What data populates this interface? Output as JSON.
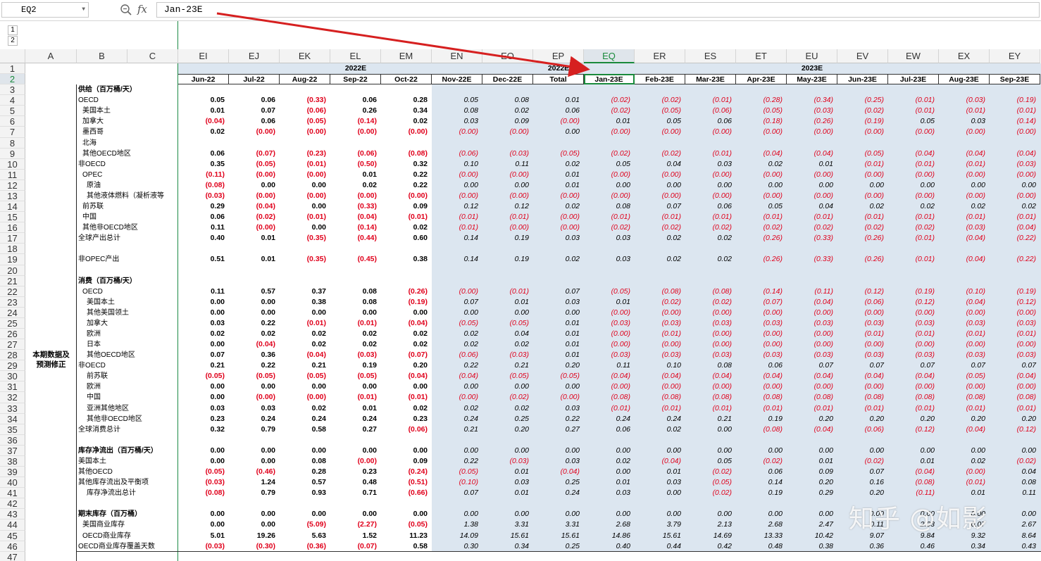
{
  "formula_bar": {
    "name_box": "EQ2",
    "formula": "Jan-23E",
    "fx_label": "fx",
    "zoom_icon": "magnifier-icon"
  },
  "outline_levels": [
    "1",
    "2"
  ],
  "columns": [
    "A",
    "B",
    "C",
    "EI",
    "EJ",
    "EK",
    "EL",
    "EM",
    "EN",
    "EO",
    "EP",
    "EQ",
    "ER",
    "ES",
    "ET",
    "EU",
    "EV",
    "EW",
    "EX",
    "EY"
  ],
  "selected_column": "EQ",
  "selected_row": 2,
  "row1": {
    "year_2022E": "2022E",
    "year_2022E_total": "2022E",
    "year_2023E": "2023E"
  },
  "row2": [
    "Jun-22",
    "Jul-22",
    "Aug-22",
    "Sep-22",
    "Oct-22",
    "Nov-22E",
    "Dec-22E",
    "Total",
    "Jan-23E",
    "Feb-23E",
    "Mar-23E",
    "Apr-23E",
    "May-23E",
    "Jun-23E",
    "Jul-23E",
    "Aug-23E",
    "Sep-23E"
  ],
  "merged_label": "本期数据及\n预测修正",
  "rows": [
    {
      "r": 3,
      "label": "供给（百万桶/天）",
      "indent": 0,
      "bold": true,
      "v": null
    },
    {
      "r": 4,
      "label": "OECD",
      "indent": 0,
      "v": [
        "0.05",
        "0.06",
        "(0.33)",
        "0.06",
        "0.28",
        "0.05",
        "0.08",
        "0.01",
        "(0.02)",
        "(0.02)",
        "(0.01)",
        "(0.28)",
        "(0.34)",
        "(0.25)",
        "(0.01)",
        "(0.03)",
        "(0.19)"
      ]
    },
    {
      "r": 5,
      "label": "美国本土",
      "indent": 2,
      "v": [
        "0.01",
        "0.07",
        "(0.06)",
        "0.26",
        "0.34",
        "0.08",
        "0.02",
        "0.06",
        "(0.02)",
        "(0.05)",
        "(0.06)",
        "(0.05)",
        "(0.03)",
        "(0.02)",
        "(0.01)",
        "(0.01)",
        "(0.01)"
      ]
    },
    {
      "r": 6,
      "label": "加拿大",
      "indent": 2,
      "v": [
        "(0.04)",
        "0.06",
        "(0.05)",
        "(0.14)",
        "0.02",
        "0.03",
        "0.09",
        "(0.00)",
        "0.01",
        "0.05",
        "0.06",
        "(0.18)",
        "(0.26)",
        "(0.19)",
        "0.05",
        "0.03",
        "(0.14)"
      ]
    },
    {
      "r": 7,
      "label": "墨西哥",
      "indent": 2,
      "v": [
        "0.02",
        "(0.00)",
        "(0.00)",
        "(0.00)",
        "(0.00)",
        "(0.00)",
        "(0.00)",
        "0.00",
        "(0.00)",
        "(0.00)",
        "(0.00)",
        "(0.00)",
        "(0.00)",
        "(0.00)",
        "(0.00)",
        "(0.00)",
        "(0.00)"
      ]
    },
    {
      "r": 8,
      "label": "北海",
      "indent": 2,
      "v": null
    },
    {
      "r": 9,
      "label": "其他OECD地区",
      "indent": 2,
      "v": [
        "0.06",
        "(0.07)",
        "(0.23)",
        "(0.06)",
        "(0.08)",
        "(0.06)",
        "(0.03)",
        "(0.05)",
        "(0.02)",
        "(0.02)",
        "(0.01)",
        "(0.04)",
        "(0.04)",
        "(0.05)",
        "(0.04)",
        "(0.04)",
        "(0.04)"
      ]
    },
    {
      "r": 10,
      "label": "非OECD",
      "indent": 0,
      "v": [
        "0.35",
        "(0.05)",
        "(0.01)",
        "(0.50)",
        "0.32",
        "0.10",
        "0.11",
        "0.02",
        "0.05",
        "0.04",
        "0.03",
        "0.02",
        "0.01",
        "(0.01)",
        "(0.01)",
        "(0.01)",
        "(0.03)"
      ]
    },
    {
      "r": 11,
      "label": "OPEC",
      "indent": 2,
      "v": [
        "(0.11)",
        "(0.00)",
        "(0.00)",
        "0.01",
        "0.22",
        "(0.00)",
        "(0.00)",
        "0.01",
        "(0.00)",
        "(0.00)",
        "(0.00)",
        "(0.00)",
        "(0.00)",
        "(0.00)",
        "(0.00)",
        "(0.00)",
        "(0.00)"
      ]
    },
    {
      "r": 12,
      "label": "原油",
      "indent": 4,
      "v": [
        "(0.08)",
        "0.00",
        "0.00",
        "0.02",
        "0.22",
        "0.00",
        "0.00",
        "0.01",
        "0.00",
        "0.00",
        "0.00",
        "0.00",
        "0.00",
        "0.00",
        "0.00",
        "0.00",
        "0.00"
      ]
    },
    {
      "r": 13,
      "label": "其他液体燃料（凝析液等",
      "indent": 4,
      "v": [
        "(0.03)",
        "(0.00)",
        "(0.00)",
        "(0.00)",
        "(0.00)",
        "(0.00)",
        "(0.00)",
        "(0.00)",
        "(0.00)",
        "(0.00)",
        "(0.00)",
        "(0.00)",
        "(0.00)",
        "(0.00)",
        "(0.00)",
        "(0.00)",
        "(0.00)"
      ]
    },
    {
      "r": 14,
      "label": "前苏联",
      "indent": 2,
      "v": [
        "0.29",
        "(0.04)",
        "0.00",
        "(0.33)",
        "0.09",
        "0.12",
        "0.12",
        "0.02",
        "0.08",
        "0.07",
        "0.06",
        "0.05",
        "0.04",
        "0.02",
        "0.02",
        "0.02",
        "0.02"
      ]
    },
    {
      "r": 15,
      "label": "中国",
      "indent": 2,
      "v": [
        "0.06",
        "(0.02)",
        "(0.01)",
        "(0.04)",
        "(0.01)",
        "(0.01)",
        "(0.01)",
        "(0.00)",
        "(0.01)",
        "(0.01)",
        "(0.01)",
        "(0.01)",
        "(0.01)",
        "(0.01)",
        "(0.01)",
        "(0.01)",
        "(0.01)"
      ]
    },
    {
      "r": 16,
      "label": "其他非OECD地区",
      "indent": 2,
      "v": [
        "0.11",
        "(0.00)",
        "0.00",
        "(0.14)",
        "0.02",
        "(0.01)",
        "(0.00)",
        "(0.00)",
        "(0.02)",
        "(0.02)",
        "(0.02)",
        "(0.02)",
        "(0.02)",
        "(0.02)",
        "(0.02)",
        "(0.03)",
        "(0.04)"
      ]
    },
    {
      "r": 17,
      "label": "全球产出总计",
      "indent": 0,
      "v": [
        "0.40",
        "0.01",
        "(0.35)",
        "(0.44)",
        "0.60",
        "0.14",
        "0.19",
        "0.03",
        "0.03",
        "0.02",
        "0.02",
        "(0.26)",
        "(0.33)",
        "(0.26)",
        "(0.01)",
        "(0.04)",
        "(0.22)"
      ]
    },
    {
      "r": 18,
      "label": "",
      "indent": 0,
      "v": null
    },
    {
      "r": 19,
      "label": "非OPEC产出",
      "indent": 0,
      "v": [
        "0.51",
        "0.01",
        "(0.35)",
        "(0.45)",
        "0.38",
        "0.14",
        "0.19",
        "0.02",
        "0.03",
        "0.02",
        "0.02",
        "(0.26)",
        "(0.33)",
        "(0.26)",
        "(0.01)",
        "(0.04)",
        "(0.22)"
      ]
    },
    {
      "r": 20,
      "label": "",
      "indent": 0,
      "v": null
    },
    {
      "r": 21,
      "label": "消费（百万桶/天）",
      "indent": 0,
      "bold": true,
      "v": null
    },
    {
      "r": 22,
      "label": "OECD",
      "indent": 2,
      "v": [
        "0.11",
        "0.57",
        "0.37",
        "0.08",
        "(0.26)",
        "(0.00)",
        "(0.01)",
        "0.07",
        "(0.05)",
        "(0.08)",
        "(0.08)",
        "(0.14)",
        "(0.11)",
        "(0.12)",
        "(0.19)",
        "(0.10)",
        "(0.19)"
      ]
    },
    {
      "r": 23,
      "label": "美国本土",
      "indent": 4,
      "v": [
        "0.00",
        "0.00",
        "0.38",
        "0.08",
        "(0.19)",
        "0.07",
        "0.01",
        "0.03",
        "0.01",
        "(0.02)",
        "(0.02)",
        "(0.07)",
        "(0.04)",
        "(0.06)",
        "(0.12)",
        "(0.04)",
        "(0.12)"
      ]
    },
    {
      "r": 24,
      "label": "其他美国领土",
      "indent": 4,
      "v": [
        "0.00",
        "0.00",
        "0.00",
        "0.00",
        "0.00",
        "0.00",
        "0.00",
        "0.00",
        "(0.00)",
        "(0.00)",
        "(0.00)",
        "(0.00)",
        "(0.00)",
        "(0.00)",
        "(0.00)",
        "(0.00)",
        "(0.00)"
      ]
    },
    {
      "r": 25,
      "label": "加拿大",
      "indent": 4,
      "v": [
        "0.03",
        "0.22",
        "(0.01)",
        "(0.01)",
        "(0.04)",
        "(0.05)",
        "(0.05)",
        "0.01",
        "(0.03)",
        "(0.03)",
        "(0.03)",
        "(0.03)",
        "(0.03)",
        "(0.03)",
        "(0.03)",
        "(0.03)",
        "(0.03)"
      ]
    },
    {
      "r": 26,
      "label": "欧洲",
      "indent": 4,
      "v": [
        "0.02",
        "0.02",
        "0.02",
        "0.02",
        "0.02",
        "0.02",
        "0.04",
        "0.01",
        "(0.00)",
        "(0.01)",
        "(0.00)",
        "(0.00)",
        "(0.00)",
        "(0.01)",
        "(0.01)",
        "(0.01)",
        "(0.01)"
      ]
    },
    {
      "r": 27,
      "label": "日本",
      "indent": 4,
      "v": [
        "0.00",
        "(0.04)",
        "0.02",
        "0.02",
        "0.02",
        "0.02",
        "0.02",
        "0.01",
        "(0.00)",
        "(0.00)",
        "(0.00)",
        "(0.00)",
        "(0.00)",
        "(0.00)",
        "(0.00)",
        "(0.00)",
        "(0.00)"
      ]
    },
    {
      "r": 28,
      "label": "其他OECD地区",
      "indent": 4,
      "v": [
        "0.07",
        "0.36",
        "(0.04)",
        "(0.03)",
        "(0.07)",
        "(0.06)",
        "(0.03)",
        "0.01",
        "(0.03)",
        "(0.03)",
        "(0.03)",
        "(0.03)",
        "(0.03)",
        "(0.03)",
        "(0.03)",
        "(0.03)",
        "(0.03)"
      ]
    },
    {
      "r": 29,
      "label": "非OECD",
      "indent": 0,
      "v": [
        "0.21",
        "0.22",
        "0.21",
        "0.19",
        "0.20",
        "0.22",
        "0.21",
        "0.20",
        "0.11",
        "0.10",
        "0.08",
        "0.06",
        "0.07",
        "0.07",
        "0.07",
        "0.07",
        "0.07"
      ]
    },
    {
      "r": 30,
      "label": "前苏联",
      "indent": 4,
      "v": [
        "(0.05)",
        "(0.05)",
        "(0.05)",
        "(0.05)",
        "(0.04)",
        "(0.04)",
        "(0.05)",
        "(0.05)",
        "(0.04)",
        "(0.04)",
        "(0.04)",
        "(0.04)",
        "(0.04)",
        "(0.04)",
        "(0.04)",
        "(0.05)",
        "(0.04)"
      ]
    },
    {
      "r": 31,
      "label": "欧洲",
      "indent": 4,
      "v": [
        "0.00",
        "0.00",
        "0.00",
        "0.00",
        "0.00",
        "0.00",
        "0.00",
        "0.00",
        "(0.00)",
        "(0.00)",
        "(0.00)",
        "(0.00)",
        "(0.00)",
        "(0.00)",
        "(0.00)",
        "(0.00)",
        "(0.00)"
      ]
    },
    {
      "r": 32,
      "label": "中国",
      "indent": 4,
      "v": [
        "0.00",
        "(0.00)",
        "(0.00)",
        "(0.01)",
        "(0.01)",
        "(0.00)",
        "(0.02)",
        "(0.00)",
        "(0.08)",
        "(0.08)",
        "(0.08)",
        "(0.08)",
        "(0.08)",
        "(0.08)",
        "(0.08)",
        "(0.08)",
        "(0.08)"
      ]
    },
    {
      "r": 33,
      "label": "亚洲其他地区",
      "indent": 4,
      "v": [
        "0.03",
        "0.03",
        "0.02",
        "0.01",
        "0.02",
        "0.02",
        "0.02",
        "0.03",
        "(0.01)",
        "(0.01)",
        "(0.01)",
        "(0.01)",
        "(0.01)",
        "(0.01)",
        "(0.01)",
        "(0.01)",
        "(0.01)"
      ]
    },
    {
      "r": 34,
      "label": "其他非OECD地区",
      "indent": 4,
      "v": [
        "0.23",
        "0.24",
        "0.24",
        "0.24",
        "0.23",
        "0.24",
        "0.25",
        "0.22",
        "0.24",
        "0.24",
        "0.21",
        "0.19",
        "0.20",
        "0.20",
        "0.20",
        "0.20",
        "0.20"
      ]
    },
    {
      "r": 35,
      "label": "全球消费总计",
      "indent": 0,
      "v": [
        "0.32",
        "0.79",
        "0.58",
        "0.27",
        "(0.06)",
        "0.21",
        "0.20",
        "0.27",
        "0.06",
        "0.02",
        "0.00",
        "(0.08)",
        "(0.04)",
        "(0.06)",
        "(0.12)",
        "(0.04)",
        "(0.12)"
      ]
    },
    {
      "r": 36,
      "label": "",
      "indent": 0,
      "v": null
    },
    {
      "r": 37,
      "label": "库存净流出（百万桶/天）",
      "indent": 0,
      "bold": true,
      "v": [
        "0.00",
        "0.00",
        "0.00",
        "0.00",
        "0.00",
        "0.00",
        "0.00",
        "0.00",
        "0.00",
        "0.00",
        "0.00",
        "0.00",
        "0.00",
        "0.00",
        "0.00",
        "0.00",
        "0.00"
      ]
    },
    {
      "r": 38,
      "label": "美国本土",
      "indent": 0,
      "v": [
        "0.00",
        "0.00",
        "0.08",
        "(0.00)",
        "0.09",
        "0.22",
        "(0.03)",
        "0.03",
        "0.02",
        "(0.04)",
        "0.05",
        "(0.02)",
        "0.01",
        "(0.02)",
        "0.01",
        "0.02",
        "(0.02)"
      ]
    },
    {
      "r": 39,
      "label": "其他OECD",
      "indent": 0,
      "v": [
        "(0.05)",
        "(0.46)",
        "0.28",
        "0.23",
        "(0.24)",
        "(0.05)",
        "0.01",
        "(0.04)",
        "0.00",
        "0.01",
        "(0.02)",
        "0.06",
        "0.09",
        "0.07",
        "(0.04)",
        "(0.00)",
        "0.04"
      ]
    },
    {
      "r": 40,
      "label": "其他库存流出及平衡项",
      "indent": 0,
      "v": [
        "(0.03)",
        "1.24",
        "0.57",
        "0.48",
        "(0.51)",
        "(0.10)",
        "0.03",
        "0.25",
        "0.01",
        "0.03",
        "(0.05)",
        "0.14",
        "0.20",
        "0.16",
        "(0.08)",
        "(0.01)",
        "0.08"
      ]
    },
    {
      "r": 41,
      "label": "库存净流出总计",
      "indent": 4,
      "v": [
        "(0.08)",
        "0.79",
        "0.93",
        "0.71",
        "(0.66)",
        "0.07",
        "0.01",
        "0.24",
        "0.03",
        "0.00",
        "(0.02)",
        "0.19",
        "0.29",
        "0.20",
        "(0.11)",
        "0.01",
        "0.11"
      ]
    },
    {
      "r": 42,
      "label": "",
      "indent": 0,
      "v": null
    },
    {
      "r": 43,
      "label": "期末库存（百万桶）",
      "indent": 0,
      "bold": true,
      "v": [
        "0.00",
        "0.00",
        "0.00",
        "0.00",
        "0.00",
        "0.00",
        "0.00",
        "0.00",
        "0.00",
        "0.00",
        "0.00",
        "0.00",
        "0.00",
        "0.00",
        "0.00",
        "0.00",
        "0.00"
      ]
    },
    {
      "r": 44,
      "label": "美国商业库存",
      "indent": 2,
      "v": [
        "0.00",
        "0.00",
        "(5.09)",
        "(2.27)",
        "(0.05)",
        "1.38",
        "3.31",
        "3.31",
        "2.68",
        "3.79",
        "2.13",
        "2.68",
        "2.47",
        "0.11",
        "2.03",
        "0.07",
        "2.67"
      ]
    },
    {
      "r": 45,
      "label": "OECD商业库存",
      "indent": 2,
      "v": [
        "5.01",
        "19.26",
        "5.63",
        "1.52",
        "11.23",
        "14.09",
        "15.61",
        "15.61",
        "14.86",
        "15.61",
        "14.69",
        "13.33",
        "10.42",
        "9.07",
        "9.84",
        "9.32",
        "8.64"
      ]
    },
    {
      "r": 46,
      "label": "OECD商业库存覆盖天数",
      "indent": 0,
      "v": [
        "(0.03)",
        "(0.30)",
        "(0.36)",
        "(0.07)",
        "0.58",
        "0.30",
        "0.34",
        "0.25",
        "0.40",
        "0.44",
        "0.42",
        "0.48",
        "0.38",
        "0.36",
        "0.46",
        "0.34",
        "0.43"
      ]
    },
    {
      "r": 47,
      "label": "",
      "indent": 0,
      "v": null
    }
  ],
  "watermark": "知乎 @如影",
  "colors": {
    "negative": "#e0001b",
    "forecast_fill": "#dce6f0",
    "header_fill": "#dce6f0",
    "selection": "#1a8a3c",
    "arrow": "#d62020"
  }
}
